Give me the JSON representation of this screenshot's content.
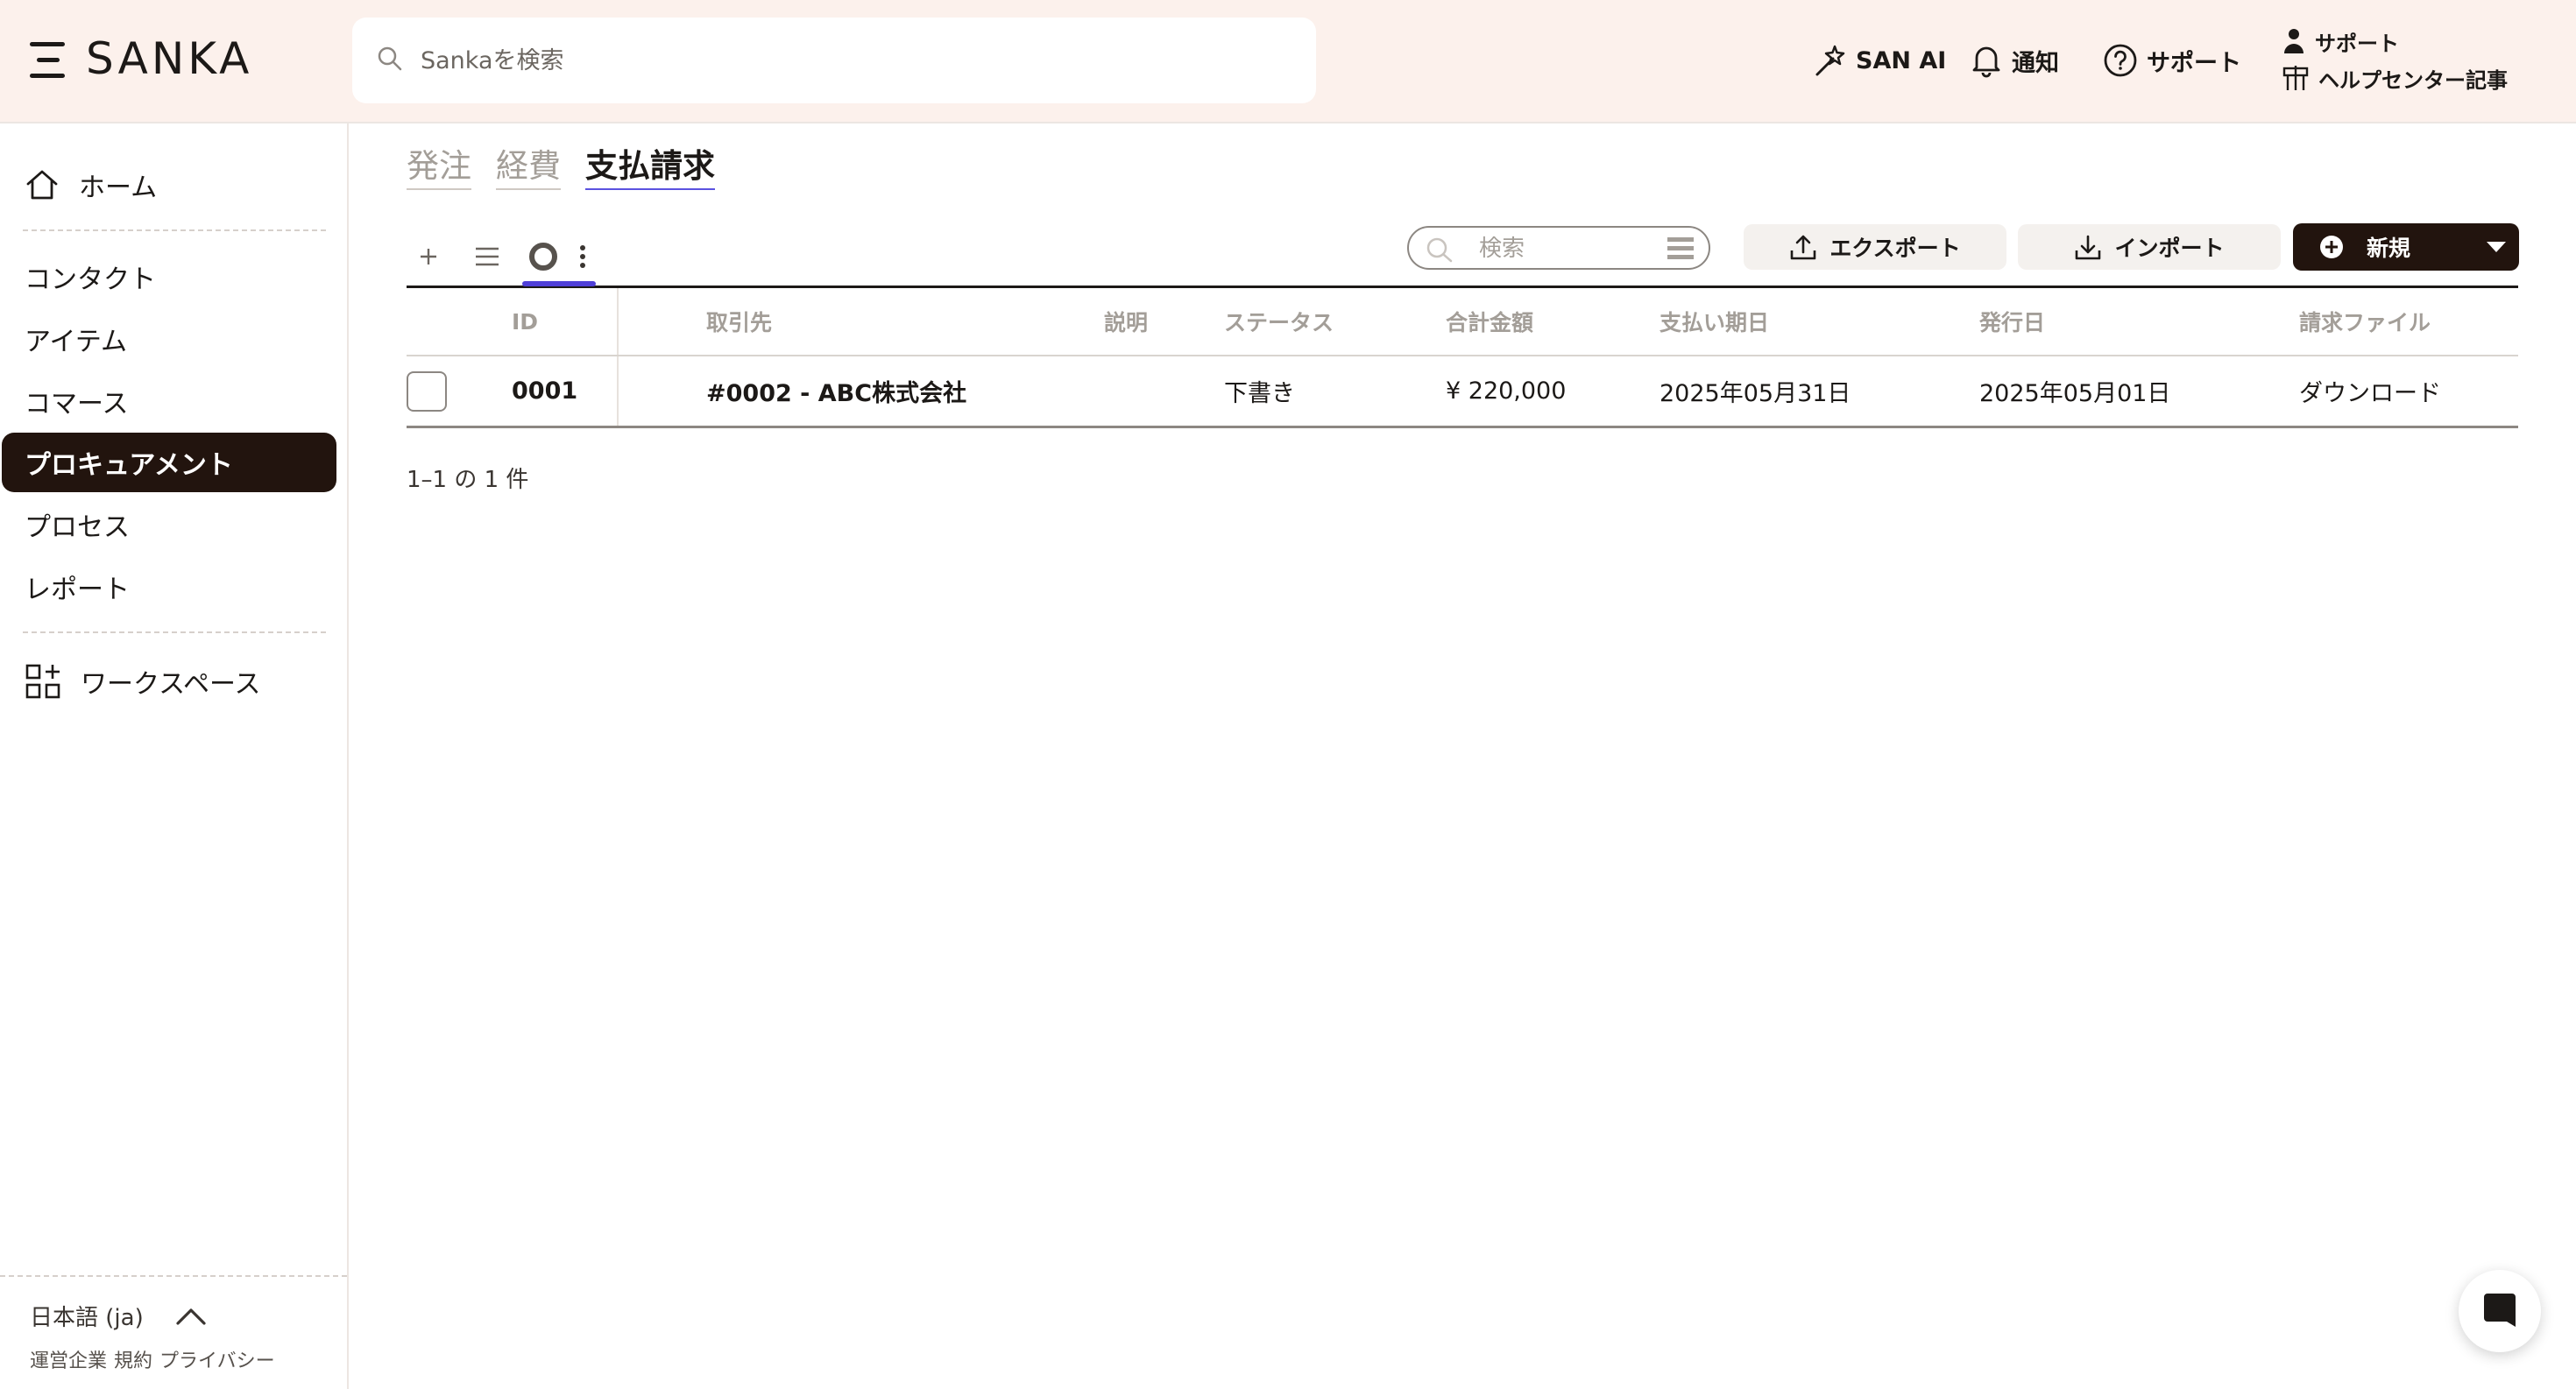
{
  "brand": {
    "name": "SANKA"
  },
  "search": {
    "placeholder": "Sankaを検索"
  },
  "header": {
    "ai_label": "SAN AI",
    "notifications_label": "通知",
    "support_label": "サポート",
    "user_menu": {
      "support_label": "サポート",
      "help_label": "ヘルプセンター記事"
    }
  },
  "sidebar": {
    "home": "ホーム",
    "items": [
      {
        "label": "コンタクト",
        "active": false
      },
      {
        "label": "アイテム",
        "active": false
      },
      {
        "label": "コマース",
        "active": false
      },
      {
        "label": "プロキュアメント",
        "active": true
      },
      {
        "label": "プロセス",
        "active": false
      },
      {
        "label": "レポート",
        "active": false
      }
    ],
    "workspace": "ワークスペース",
    "language": "日本語 (ja)",
    "legal": [
      "運営企業",
      "規約",
      "プライバシー"
    ]
  },
  "tabs": [
    {
      "label": "発注",
      "active": false
    },
    {
      "label": "経費",
      "active": false
    },
    {
      "label": "支払請求",
      "active": true
    }
  ],
  "toolbar": {
    "search_placeholder": "検索",
    "export_label": "エクスポート",
    "import_label": "インポート",
    "new_label": "新規"
  },
  "table": {
    "columns": [
      "ID",
      "取引先",
      "説明",
      "ステータス",
      "合計金額",
      "支払い期日",
      "発行日",
      "請求ファイル"
    ],
    "rows": [
      {
        "id": "0001",
        "partner": "#0002 - ABC株式会社",
        "description": "",
        "status": "下書き",
        "total": "¥ 220,000",
        "due_date": "2025年05月31日",
        "issue_date": "2025年05月01日",
        "file": "ダウンロード"
      }
    ]
  },
  "pagination": {
    "text": "1–1 の 1 件"
  },
  "colors": {
    "accent": "#4f3fd8",
    "active_nav": "#22140e",
    "header_bg": "#fcf1ec",
    "link": "#3a2fd6"
  }
}
